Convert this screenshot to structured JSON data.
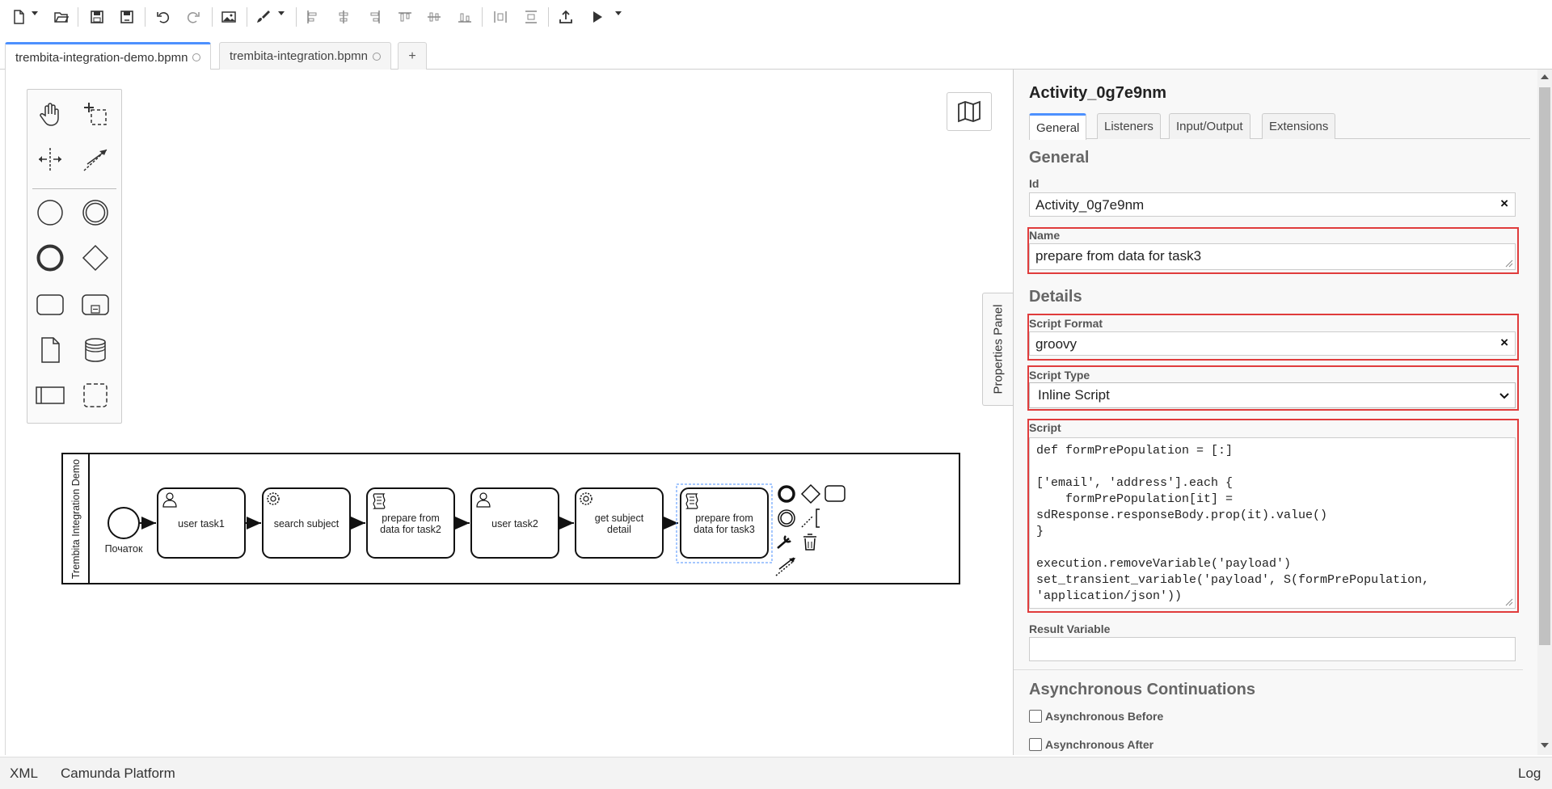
{
  "toolbar": {
    "icons": [
      "new-file-icon",
      "open-folder-icon",
      "save-icon",
      "save-as-icon",
      "undo-icon",
      "redo-icon",
      "export-image-icon",
      "color-brush-icon",
      "align-left-icon",
      "align-center-icon",
      "align-right-icon",
      "align-top-icon",
      "align-middle-icon",
      "align-bottom-icon",
      "distribute-horizontal-icon",
      "distribute-vertical-icon",
      "deploy-icon",
      "run-icon"
    ]
  },
  "tabs": [
    {
      "label": "trembita-integration-demo.bpmn",
      "active": true
    },
    {
      "label": "trembita-integration.bpmn",
      "active": false
    }
  ],
  "tab_add_label": "+",
  "diagram": {
    "pool_label": "Trembita Integration Demo",
    "start_event_label": "Початок",
    "tasks": [
      {
        "label": "user task1",
        "icon": "user-icon"
      },
      {
        "label": "search subject",
        "icon": "gear-icon"
      },
      {
        "label": "prepare from data for task2",
        "icon": "script-icon"
      },
      {
        "label": "user task2",
        "icon": "user-icon"
      },
      {
        "label": "get subject detail",
        "icon": "gear-icon"
      },
      {
        "label": "prepare from data for task3",
        "icon": "script-icon"
      }
    ]
  },
  "properties_toggle_label": "Properties Panel",
  "properties": {
    "title": "Activity_0g7e9nm",
    "tabs": [
      "General",
      "Listeners",
      "Input/Output",
      "Extensions"
    ],
    "active_tab": "General",
    "general_group": "General",
    "id_label": "Id",
    "id_value": "Activity_0g7e9nm",
    "name_label": "Name",
    "name_value": "prepare from data for task3",
    "details_group": "Details",
    "script_format_label": "Script Format",
    "script_format_value": "groovy",
    "script_type_label": "Script Type",
    "script_type_value": "Inline Script",
    "script_label": "Script",
    "script_value": "def formPrePopulation = [:]\n\n['email', 'address'].each {\n    formPrePopulation[it] =\nsdResponse.responseBody.prop(it).value()\n}\n\nexecution.removeVariable('payload')\nset_transient_variable('payload', S(formPrePopulation,\n'application/json'))",
    "result_variable_label": "Result Variable",
    "result_variable_value": "",
    "async_group": "Asynchronous Continuations",
    "async_before_label": "Asynchronous Before",
    "async_after_label": "Asynchronous After",
    "clear_symbol": "×"
  },
  "statusbar": {
    "xml_label": "XML",
    "platform_label": "Camunda Platform",
    "log_label": "Log"
  },
  "colors": {
    "accent": "#4d90fe",
    "highlight": "#e03c3c",
    "selection": "#4d90fe"
  }
}
